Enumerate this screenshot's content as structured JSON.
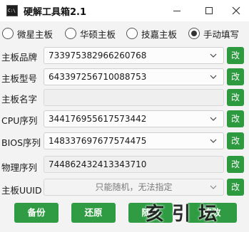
{
  "window": {
    "title": "硬解工具箱2.1",
    "icon": "console-app-icon"
  },
  "modes": [
    {
      "label": "微星主板",
      "checked": false
    },
    {
      "label": "华硕主板",
      "checked": false
    },
    {
      "label": "技嘉主板",
      "checked": false
    },
    {
      "label": "手动填写",
      "checked": true
    }
  ],
  "rows": [
    {
      "label": "主板品牌",
      "value": "733975382966260768",
      "kind": "combo",
      "button": "改"
    },
    {
      "label": "主板型号",
      "value": "643397256710088753",
      "kind": "combo",
      "button": "改"
    },
    {
      "label": "主板名字",
      "value": "",
      "kind": "readonly",
      "button": "改"
    },
    {
      "label": "CPU序列",
      "value": "344176955617573442",
      "kind": "combo",
      "button": "改"
    },
    {
      "label": "BIOS序列",
      "value": "148337697677574475",
      "kind": "combo",
      "button": "改"
    },
    {
      "label": "物理序列",
      "value": "744862432413343710",
      "kind": "readonly",
      "button": "改"
    },
    {
      "label": "主板UUID",
      "value": "只能随机，无法指定",
      "kind": "disabled-combo",
      "button": "改"
    }
  ],
  "actions": {
    "backup": "备份",
    "restore": "还原",
    "random": "随机",
    "apply": "修改"
  },
  "watermark": "亥 引 坛",
  "colors": {
    "accent_green": "#2f9c43",
    "background": "#f3f3f3",
    "titlebar": "#ffffff"
  }
}
